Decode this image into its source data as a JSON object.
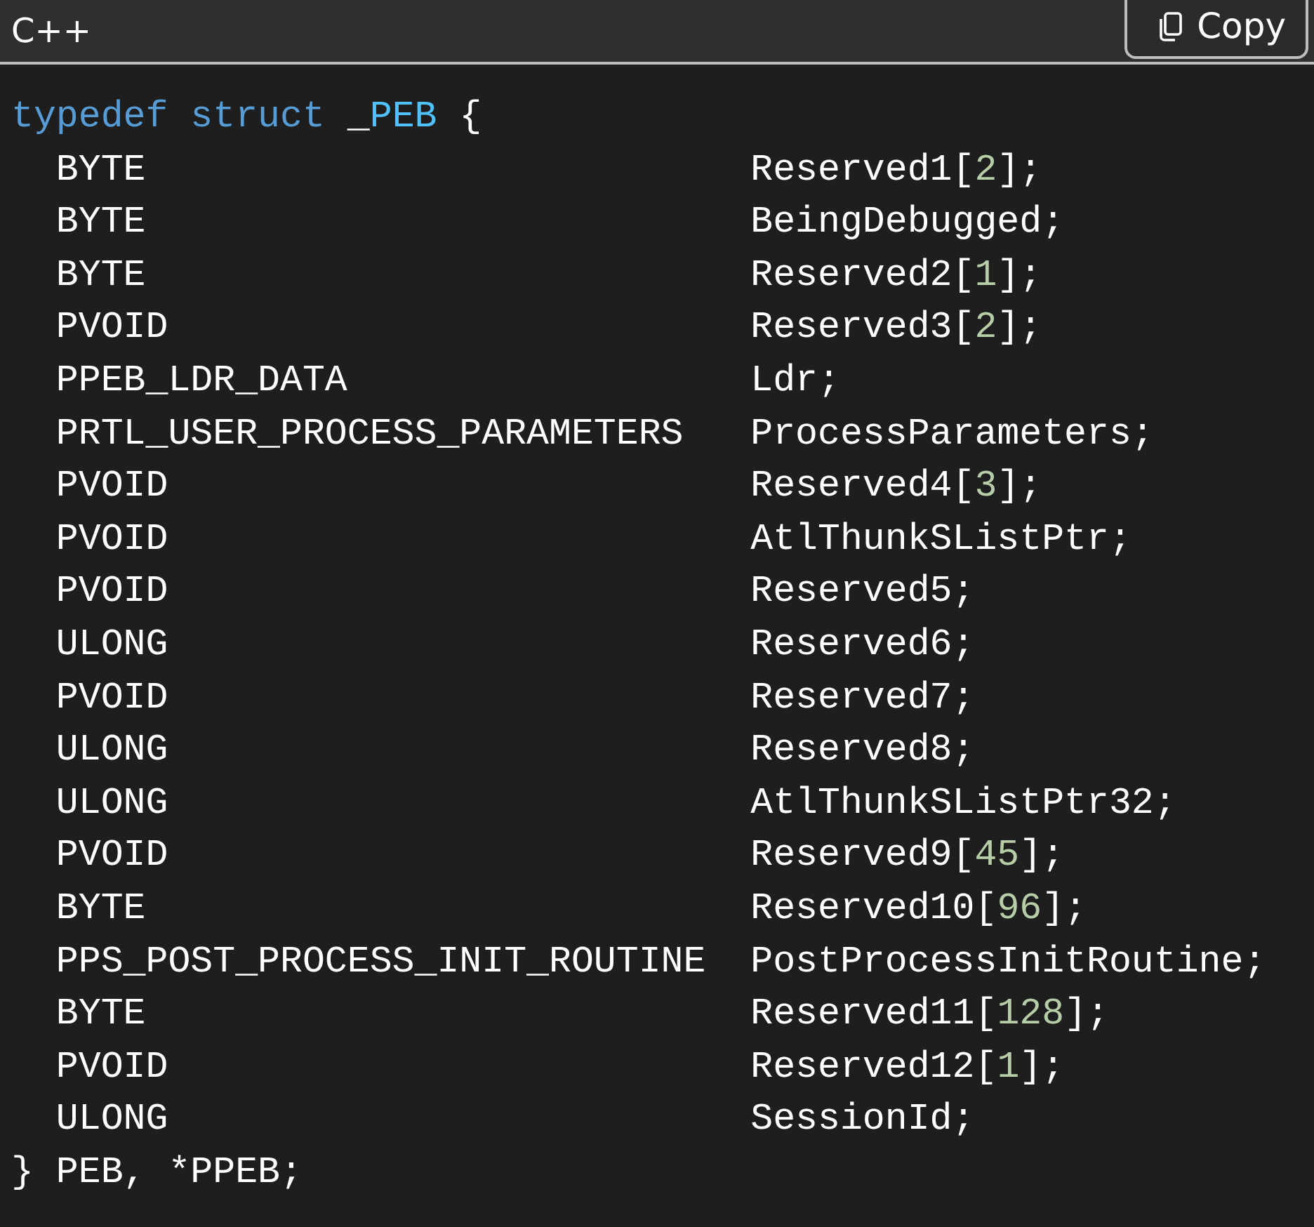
{
  "header": {
    "language": "C++",
    "copy_button": "Copy"
  },
  "code": {
    "opening": [
      {
        "kind": "keyword",
        "text": "typedef"
      },
      {
        "kind": "keyword",
        "text": " struct"
      },
      {
        "kind": "plain",
        "text": " _"
      },
      {
        "kind": "type",
        "text": "PEB"
      },
      {
        "kind": "plain",
        "text": " {"
      }
    ],
    "members": [
      {
        "type": "BYTE",
        "field": [
          {
            "kind": "plain",
            "text": "Reserved1["
          },
          {
            "kind": "number",
            "text": "2"
          },
          {
            "kind": "plain",
            "text": "];"
          }
        ]
      },
      {
        "type": "BYTE",
        "field": [
          {
            "kind": "plain",
            "text": "BeingDebugged;"
          }
        ]
      },
      {
        "type": "BYTE",
        "field": [
          {
            "kind": "plain",
            "text": "Reserved2["
          },
          {
            "kind": "number",
            "text": "1"
          },
          {
            "kind": "plain",
            "text": "];"
          }
        ]
      },
      {
        "type": "PVOID",
        "field": [
          {
            "kind": "plain",
            "text": "Reserved3["
          },
          {
            "kind": "number",
            "text": "2"
          },
          {
            "kind": "plain",
            "text": "];"
          }
        ]
      },
      {
        "type": "PPEB_LDR_DATA",
        "field": [
          {
            "kind": "plain",
            "text": "Ldr;"
          }
        ]
      },
      {
        "type": "PRTL_USER_PROCESS_PARAMETERS",
        "field": [
          {
            "kind": "plain",
            "text": "ProcessParameters;"
          }
        ]
      },
      {
        "type": "PVOID",
        "field": [
          {
            "kind": "plain",
            "text": "Reserved4["
          },
          {
            "kind": "number",
            "text": "3"
          },
          {
            "kind": "plain",
            "text": "];"
          }
        ]
      },
      {
        "type": "PVOID",
        "field": [
          {
            "kind": "plain",
            "text": "AtlThunkSListPtr;"
          }
        ]
      },
      {
        "type": "PVOID",
        "field": [
          {
            "kind": "plain",
            "text": "Reserved5;"
          }
        ]
      },
      {
        "type": "ULONG",
        "field": [
          {
            "kind": "plain",
            "text": "Reserved6;"
          }
        ]
      },
      {
        "type": "PVOID",
        "field": [
          {
            "kind": "plain",
            "text": "Reserved7;"
          }
        ]
      },
      {
        "type": "ULONG",
        "field": [
          {
            "kind": "plain",
            "text": "Reserved8;"
          }
        ]
      },
      {
        "type": "ULONG",
        "field": [
          {
            "kind": "plain",
            "text": "AtlThunkSListPtr32;"
          }
        ]
      },
      {
        "type": "PVOID",
        "field": [
          {
            "kind": "plain",
            "text": "Reserved9["
          },
          {
            "kind": "number",
            "text": "45"
          },
          {
            "kind": "plain",
            "text": "];"
          }
        ]
      },
      {
        "type": "BYTE",
        "field": [
          {
            "kind": "plain",
            "text": "Reserved10["
          },
          {
            "kind": "number",
            "text": "96"
          },
          {
            "kind": "plain",
            "text": "];"
          }
        ]
      },
      {
        "type": "PPS_POST_PROCESS_INIT_ROUTINE",
        "field": [
          {
            "kind": "plain",
            "text": "PostProcessInitRoutine;"
          }
        ]
      },
      {
        "type": "BYTE",
        "field": [
          {
            "kind": "plain",
            "text": "Reserved11["
          },
          {
            "kind": "number",
            "text": "128"
          },
          {
            "kind": "plain",
            "text": "];"
          }
        ]
      },
      {
        "type": "PVOID",
        "field": [
          {
            "kind": "plain",
            "text": "Reserved12["
          },
          {
            "kind": "number",
            "text": "1"
          },
          {
            "kind": "plain",
            "text": "];"
          }
        ]
      },
      {
        "type": "ULONG",
        "field": [
          {
            "kind": "plain",
            "text": "SessionId;"
          }
        ]
      }
    ],
    "closing": "} PEB, *PPEB;"
  }
}
